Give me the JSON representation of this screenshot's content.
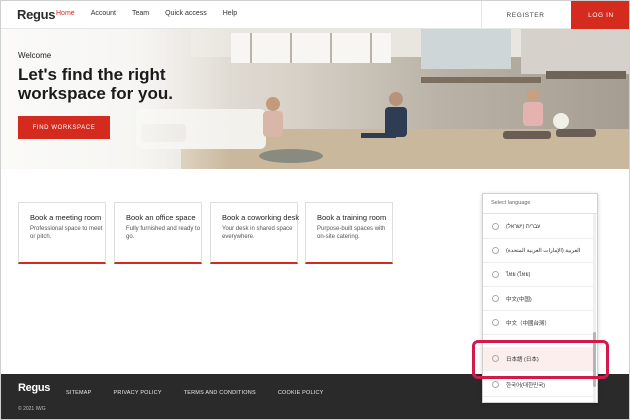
{
  "header": {
    "logo": "Regus",
    "nav": [
      "Home",
      "Account",
      "Team",
      "Quick access",
      "Help"
    ],
    "register": "REGISTER",
    "login": "LOG IN"
  },
  "hero": {
    "welcome": "Welcome",
    "headline": "Let's find the right workspace for you.",
    "button": "FIND WORKSPACE"
  },
  "cards": [
    {
      "title": "Book a meeting room",
      "desc": "Professional space to meet or pitch."
    },
    {
      "title": "Book an office space",
      "desc": "Fully furnished and ready to go."
    },
    {
      "title": "Book a coworking desk",
      "desc": "Your desk in shared space everywhere."
    },
    {
      "title": "Book a training room",
      "desc": "Purpose-built spaces with on-site catering."
    }
  ],
  "language": {
    "label": "Select language",
    "options": [
      "עברית (ישראל)",
      "العربية (الإمارات العربية المتحدة)",
      "ไทย (ไทย)",
      "中文(中国)",
      "中文（中國台灣）",
      "日本語 (日本)",
      "한국어(대한민국)"
    ],
    "highlighted_index": 5
  },
  "footer": {
    "logo": "Regus",
    "links": [
      "SITEMAP",
      "PRIVACY POLICY",
      "TERMS AND CONDITIONS",
      "COOKIE POLICY"
    ],
    "copyright": "© 2021 IWG"
  },
  "colors": {
    "accent": "#d52b1e",
    "highlight": "#d4184a",
    "footer_bg": "#2a2a2a"
  }
}
